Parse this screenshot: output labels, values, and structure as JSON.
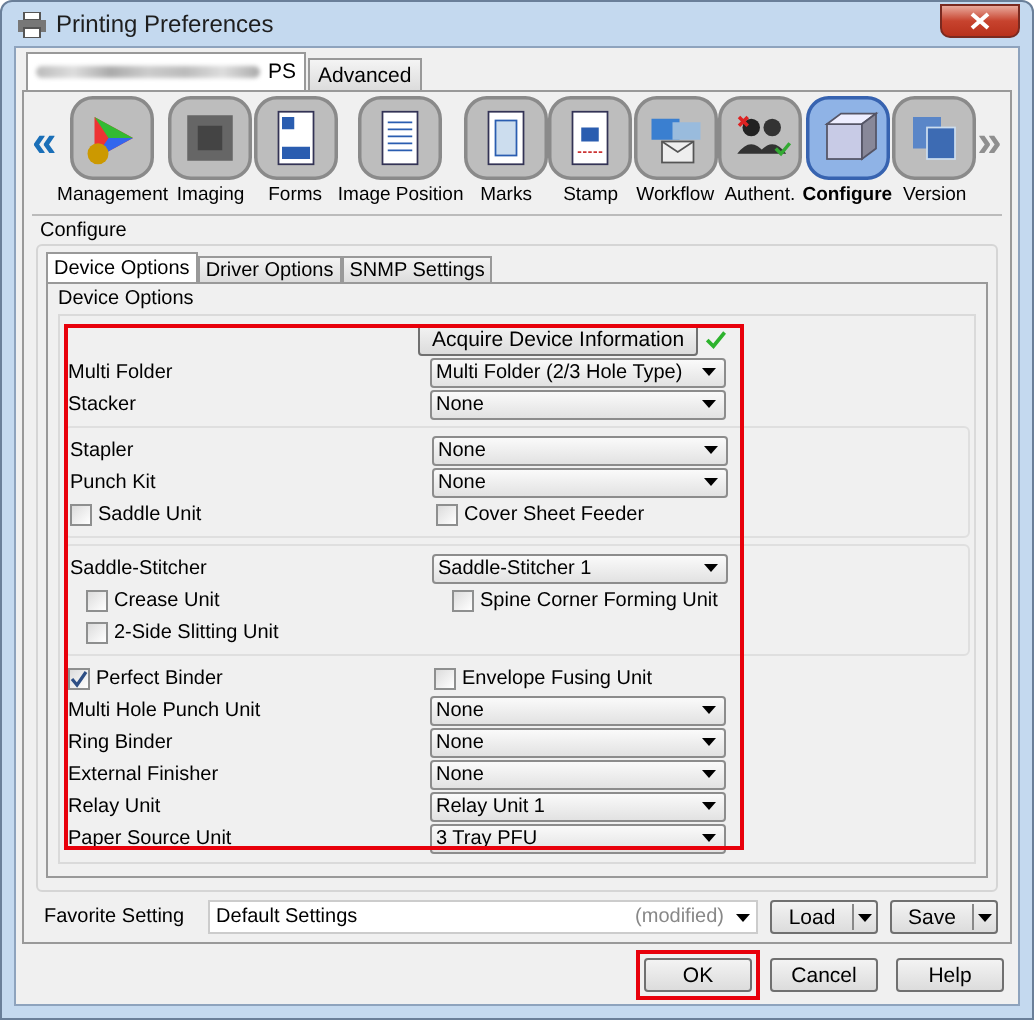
{
  "window": {
    "title": "Printing Preferences"
  },
  "tabs": [
    {
      "label": "PS",
      "selected": true,
      "blurred": true
    },
    {
      "label": "Advanced",
      "selected": false
    }
  ],
  "toolbar": {
    "items": [
      {
        "label": "Management",
        "selected": false
      },
      {
        "label": "Imaging",
        "selected": false
      },
      {
        "label": "Forms",
        "selected": false
      },
      {
        "label": "Image Position",
        "selected": false
      },
      {
        "label": "Marks",
        "selected": false
      },
      {
        "label": "Stamp",
        "selected": false
      },
      {
        "label": "Workflow",
        "selected": false
      },
      {
        "label": "Authent.",
        "selected": false
      },
      {
        "label": "Configure",
        "selected": true
      },
      {
        "label": "Version",
        "selected": false
      }
    ],
    "prev": "«",
    "next": "»",
    "next_disabled": true
  },
  "group": {
    "title": "Configure",
    "tabs": [
      {
        "label": "Device Options",
        "selected": true
      },
      {
        "label": "Driver Options",
        "selected": false
      },
      {
        "label": "SNMP Settings",
        "selected": false
      }
    ],
    "panel": {
      "title": "Device Options",
      "highlighted": true,
      "sections": [
        {
          "framed": false,
          "rows": [
            {
              "kind": "button",
              "label": "Acquire Device Information",
              "acquired": true
            },
            {
              "kind": "select",
              "label": "Multi Folder",
              "value": "Multi Folder (2/3 Hole Type)"
            },
            {
              "kind": "select",
              "label": "Stacker",
              "value": "None"
            }
          ]
        },
        {
          "framed": true,
          "rows": [
            {
              "kind": "select",
              "label": "Stapler",
              "value": "None"
            },
            {
              "kind": "select",
              "label": "Punch Kit",
              "value": "None"
            },
            {
              "kind": "checks",
              "items": [
                {
                  "label": "Saddle Unit",
                  "checked": false
                },
                {
                  "label": "Cover Sheet Feeder",
                  "checked": false
                }
              ]
            }
          ]
        },
        {
          "framed": true,
          "rows": [
            {
              "kind": "select",
              "label": "Saddle-Stitcher",
              "value": "Saddle-Stitcher 1",
              "children": [
                {
                  "kind": "checks",
                  "items": [
                    {
                      "label": "Crease Unit",
                      "checked": false
                    },
                    {
                      "label": "Spine Corner Forming Unit",
                      "checked": false
                    }
                  ]
                },
                {
                  "kind": "checks",
                  "items": [
                    {
                      "label": "2-Side Slitting Unit",
                      "checked": false
                    }
                  ]
                }
              ]
            }
          ]
        },
        {
          "framed": false,
          "rows": [
            {
              "kind": "checks",
              "items": [
                {
                  "label": "Perfect Binder",
                  "checked": true
                },
                {
                  "label": "Envelope Fusing Unit",
                  "checked": false
                }
              ]
            },
            {
              "kind": "select",
              "label": "Multi Hole Punch Unit",
              "value": "None"
            },
            {
              "kind": "select",
              "label": "Ring Binder",
              "value": "None"
            },
            {
              "kind": "select",
              "label": "External Finisher",
              "value": "None"
            },
            {
              "kind": "select",
              "label": "Relay Unit",
              "value": "Relay Unit 1"
            },
            {
              "kind": "select",
              "label": "Paper Source Unit",
              "value": "3 Tray PFU"
            }
          ]
        }
      ]
    }
  },
  "favorite": {
    "label": "Favorite Setting",
    "value": "Default Settings",
    "note": "(modified)",
    "buttons": [
      "Load",
      "Save"
    ]
  },
  "buttons": [
    {
      "label": "OK",
      "highlighted": true
    },
    {
      "label": "Cancel",
      "highlighted": false
    },
    {
      "label": "Help",
      "highlighted": false
    }
  ]
}
